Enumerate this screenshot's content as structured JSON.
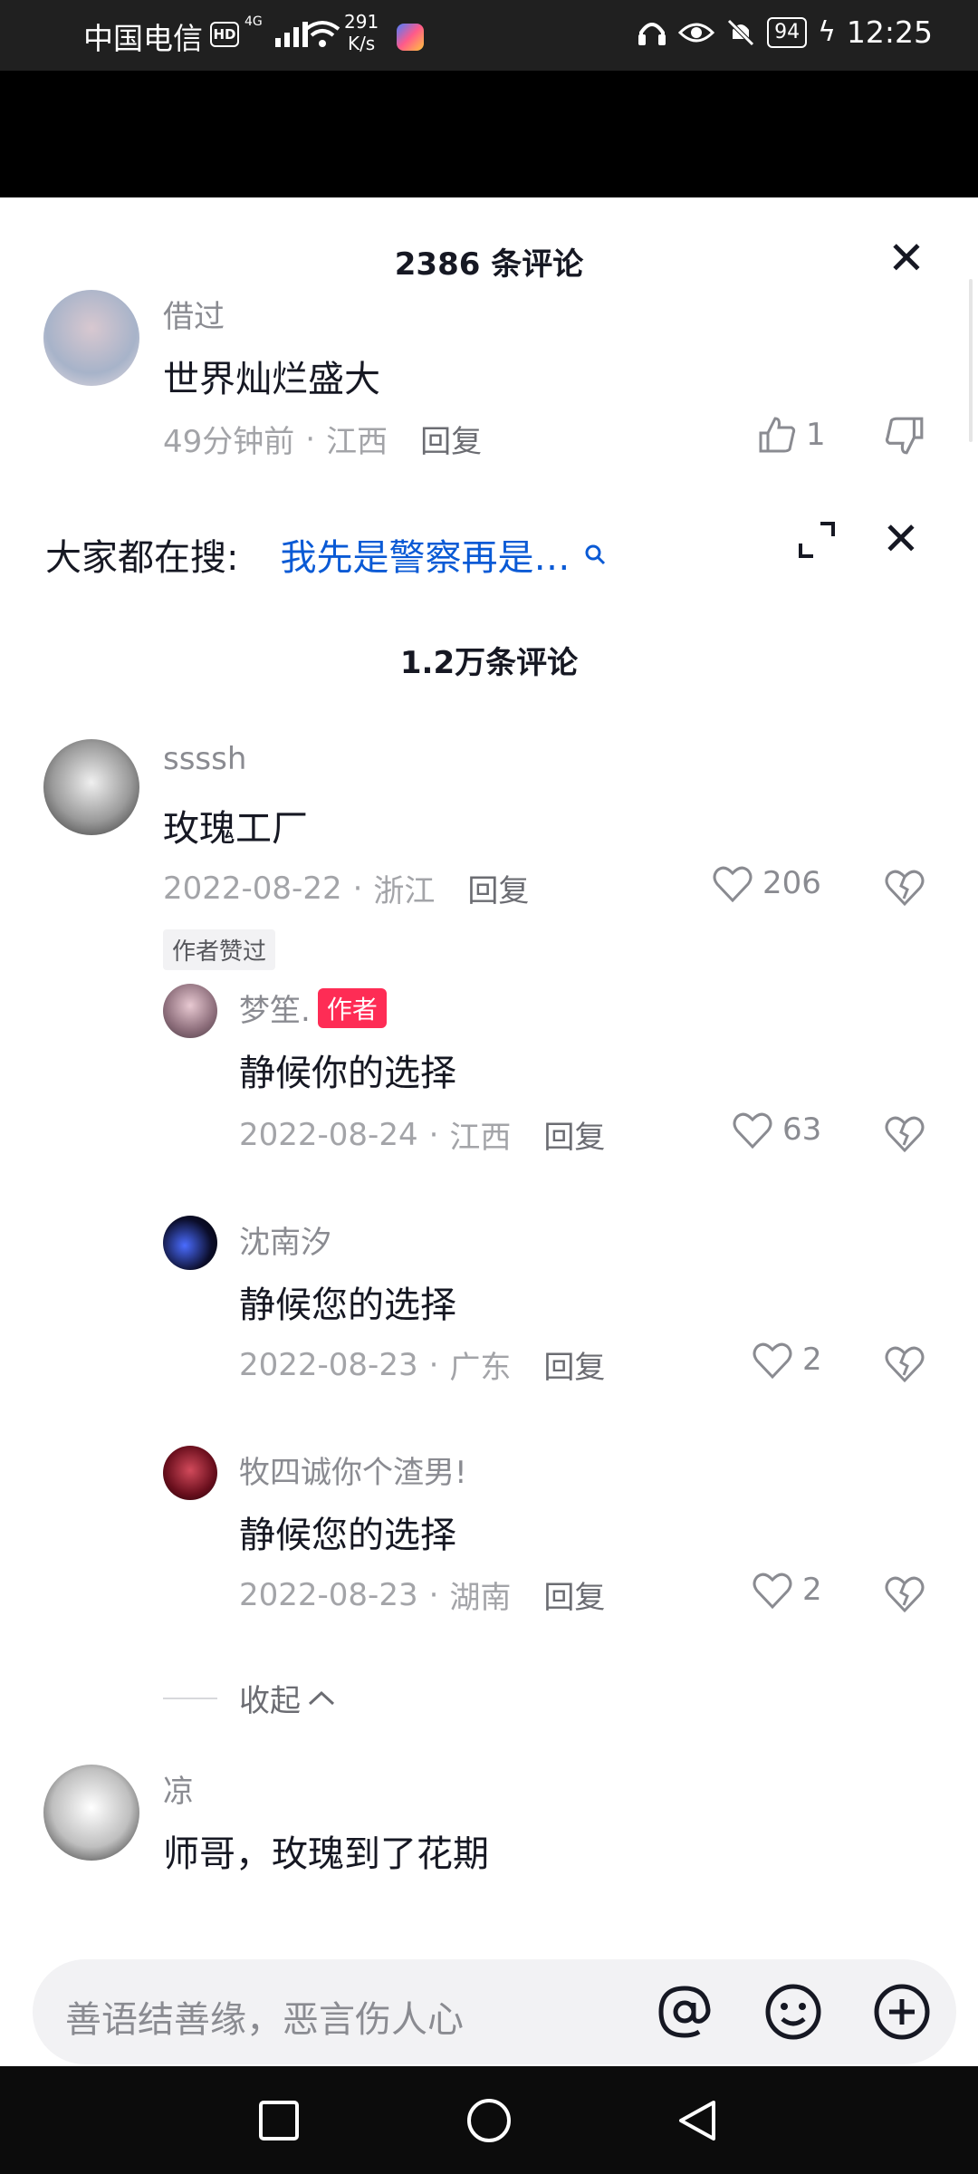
{
  "status_bar": {
    "carrier": "中国电信",
    "hd": "HD",
    "network": "4G",
    "speed_value": "291",
    "speed_unit": "K/s",
    "battery": "94",
    "time": "12:25"
  },
  "sheet_top": {
    "peek_text": "…",
    "title": "2386 条评论",
    "comment": {
      "username": "借过",
      "text": "世界灿烂盛大",
      "time": "49分钟前",
      "location": "江西",
      "reply": "回复",
      "likes": "1"
    }
  },
  "search": {
    "label": "大家都在搜:",
    "term": "我先是警察再是…"
  },
  "comments_title": "1.2万条评论",
  "comments": [
    {
      "username": "ssssh",
      "text": "玫瑰工厂",
      "date": "2022-08-22",
      "location": "浙江",
      "reply": "回复",
      "likes": "206",
      "tag": "作者赞过"
    },
    {
      "username": "梦笙.",
      "badge": "作者",
      "text": "静候你的选择",
      "date": "2022-08-24",
      "location": "江西",
      "reply": "回复",
      "likes": "63"
    },
    {
      "username": "沈南汐",
      "text": "静候您的选择",
      "date": "2022-08-23",
      "location": "广东",
      "reply": "回复",
      "likes": "2"
    },
    {
      "username": "牧四诚你个渣男!",
      "text": "静候您的选择",
      "date": "2022-08-23",
      "location": "湖南",
      "reply": "回复",
      "likes": "2"
    },
    {
      "username": "凉",
      "text": "师哥，玫瑰到了花期"
    }
  ],
  "collapse_label": "收起",
  "input": {
    "placeholder": "善语结善缘，恶言伤人心"
  },
  "icons": {
    "close": "close-icon",
    "expand": "expand-icon",
    "search": "search-icon",
    "thumb_up": "thumb-up-icon",
    "thumb_down": "thumb-down-icon",
    "heart": "heart-icon",
    "broken_heart": "broken-heart-icon",
    "mention": "at-icon",
    "emoji": "emoji-icon",
    "add": "plus-circle-icon"
  },
  "colors": {
    "search_term": "#0a5ad5",
    "author_badge": "#fe2c55"
  }
}
